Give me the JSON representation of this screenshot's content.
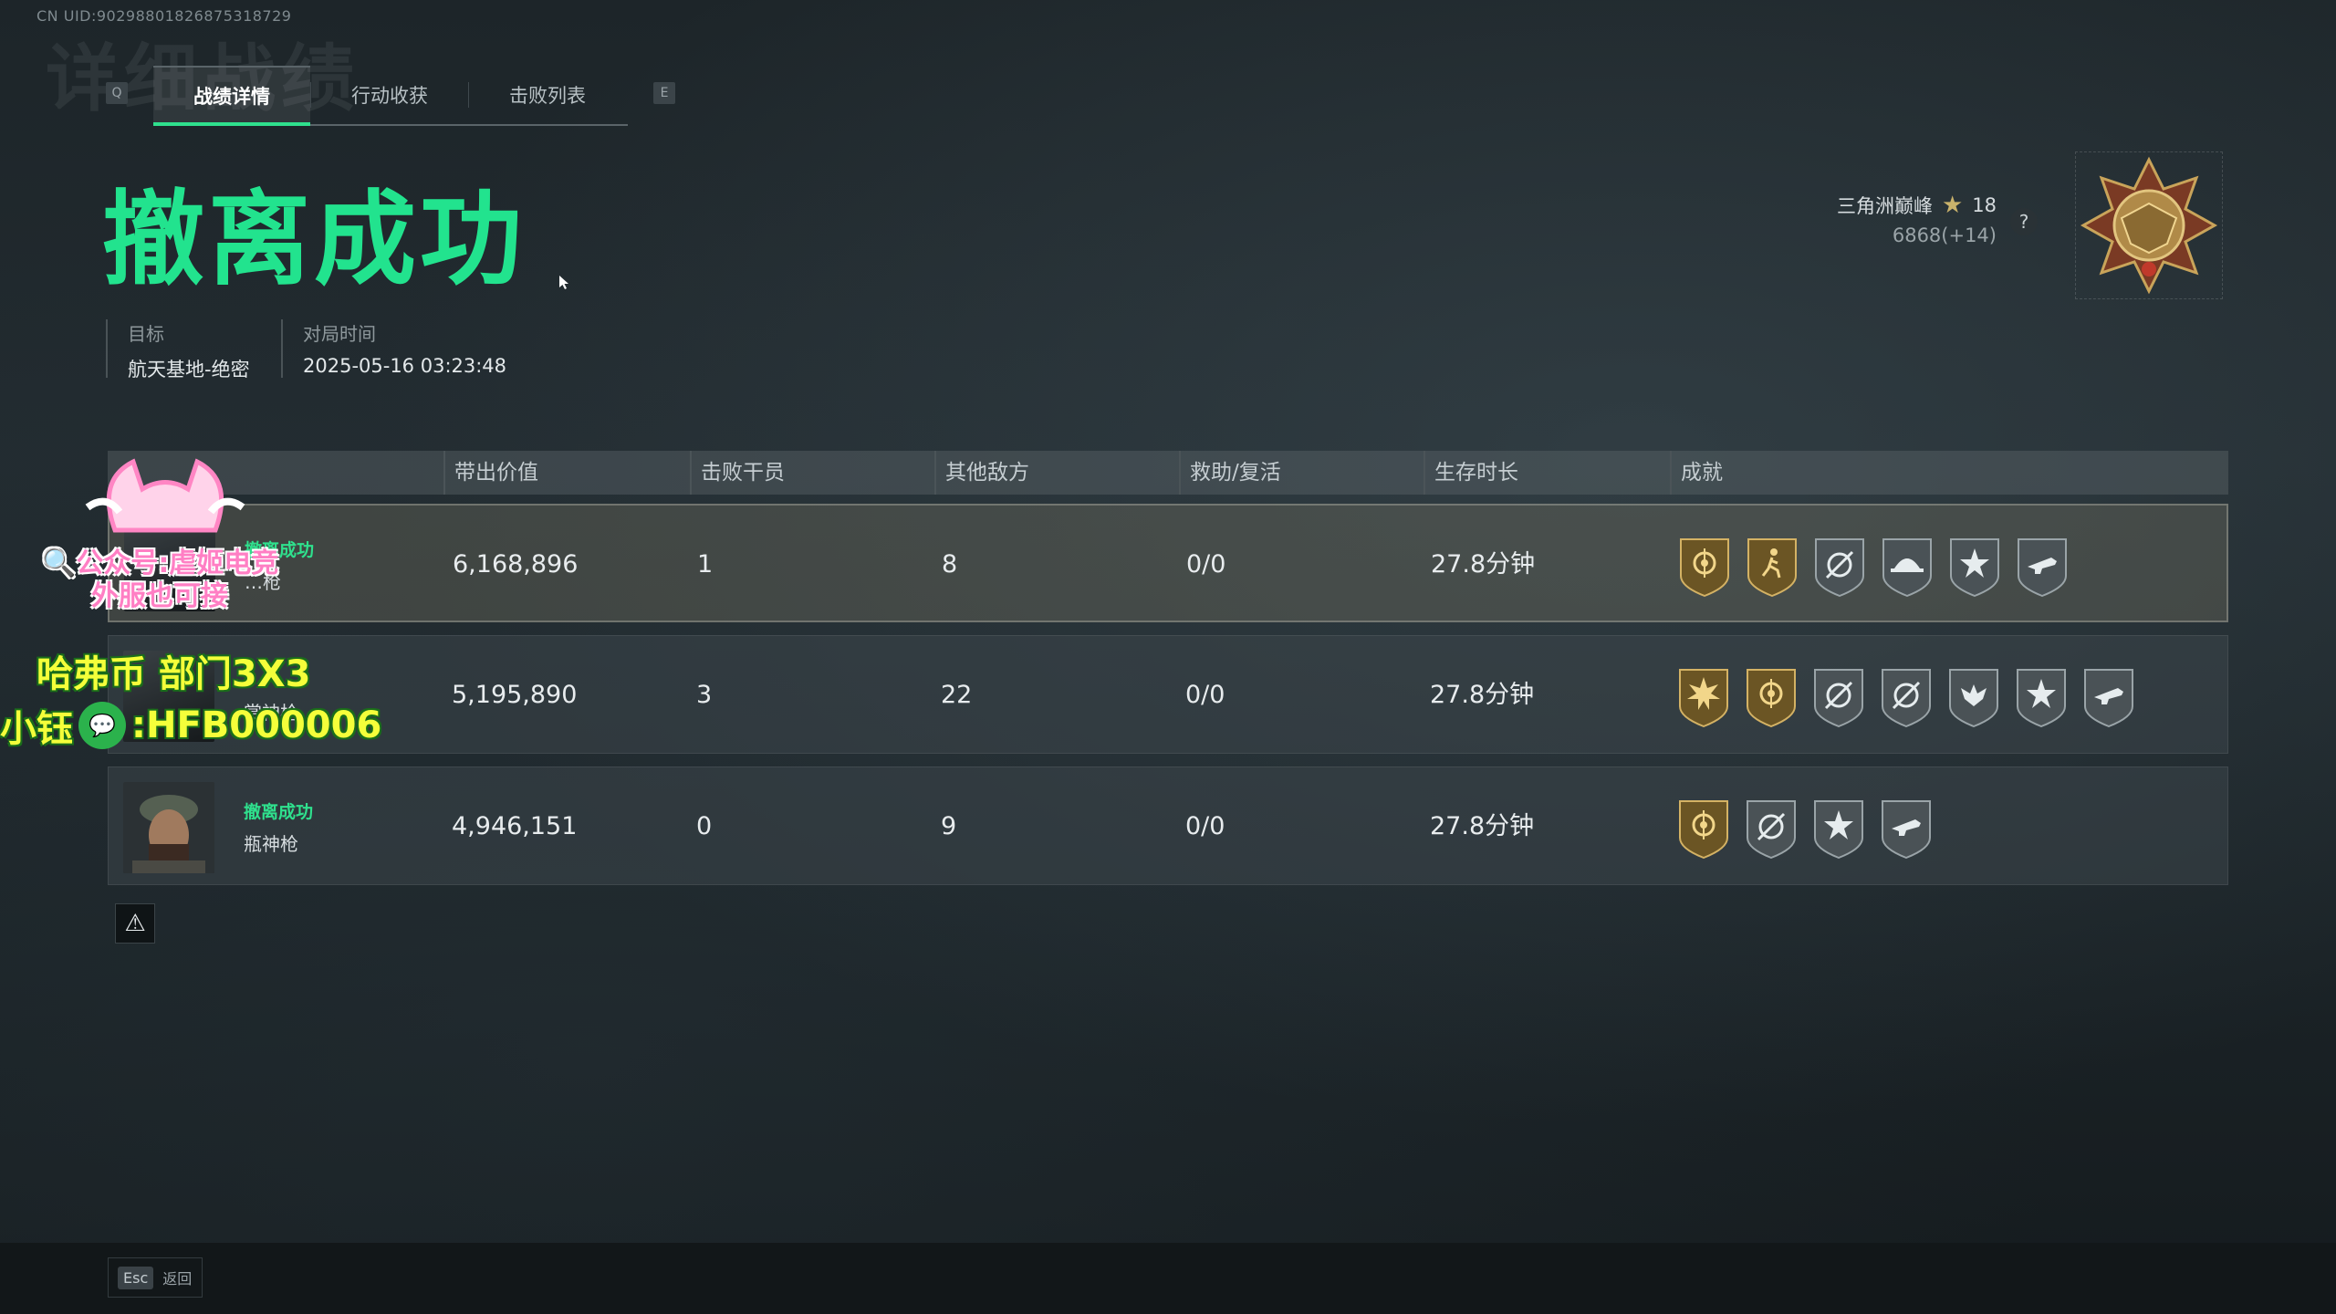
{
  "uid_text": "CN UID:90298801826875318729",
  "background_title": "详细战绩",
  "tabs": {
    "prev_key": "Q",
    "next_key": "E",
    "items": [
      "战绩详情",
      "行动收获",
      "击败列表"
    ],
    "active": 0
  },
  "result_title": "撤离成功",
  "target": {
    "label": "目标",
    "value": "航天基地-绝密"
  },
  "match_time": {
    "label": "对局时间",
    "value": "2025-05-16 03:23:48"
  },
  "rank": {
    "name": "三角洲巅峰",
    "stars": "18",
    "score": "6868(+14)",
    "help": "?"
  },
  "table": {
    "headers": [
      "带出价值",
      "击败干员",
      "其他敌方",
      "救助/复活",
      "生存时长",
      "成就"
    ],
    "rows": [
      {
        "status": "撤离成功",
        "name": "…枪",
        "value": "6,168,896",
        "operators": "1",
        "others": "8",
        "assist": "0/0",
        "survival": "27.8分钟",
        "achievements": [
          "gold-target-icon",
          "gold-runner-icon",
          "silver-crosshair-icon",
          "silver-helmet-icon",
          "silver-star-icon",
          "silver-gun-icon"
        ]
      },
      {
        "status": "",
        "name": "赏神枪",
        "value": "5,195,890",
        "operators": "3",
        "others": "22",
        "assist": "0/0",
        "survival": "27.8分钟",
        "achievements": [
          "gold-burst-icon",
          "gold-target-icon",
          "silver-crosshair-icon",
          "silver-crosshair-icon",
          "silver-wings-icon",
          "silver-star-icon",
          "silver-gun-icon"
        ]
      },
      {
        "status": "撤离成功",
        "name": "瓶神枪",
        "value": "4,946,151",
        "operators": "0",
        "others": "9",
        "assist": "0/0",
        "survival": "27.8分钟",
        "achievements": [
          "gold-target-icon",
          "silver-crosshair-icon",
          "silver-star-icon",
          "silver-gun-icon"
        ]
      }
    ]
  },
  "footer": {
    "key": "Esc",
    "label": "返回"
  },
  "overlay": {
    "line1": "🔍公众号:虐姬电竞",
    "line1b": "外服也可接",
    "line2": "哈弗币 部门3X3",
    "line3_prefix": "小钰",
    "line3_id": ":HFB000006"
  }
}
